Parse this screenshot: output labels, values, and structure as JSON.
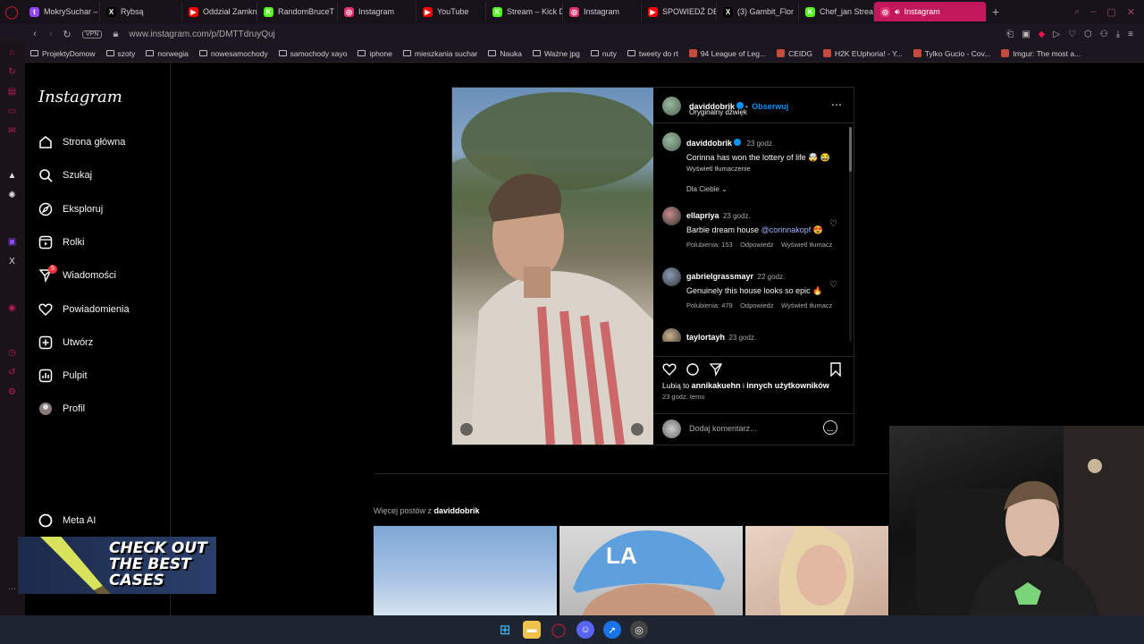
{
  "browser": {
    "tabs": [
      {
        "label": "MokrySuchar – ",
        "icon": "twitch-icon",
        "color": "#9146ff",
        "glyph": "t"
      },
      {
        "label": "Rybsą",
        "icon": "x-icon",
        "color": "#000000",
        "glyph": "X"
      },
      {
        "label": "Oddział Zamkn",
        "icon": "youtube-icon",
        "color": "#ff0000",
        "glyph": "▶"
      },
      {
        "label": "RandomBruceT",
        "icon": "kick-icon",
        "color": "#53fc18",
        "glyph": "K"
      },
      {
        "label": "Instagram",
        "icon": "instagram-icon",
        "color": "#e1306c",
        "glyph": "◎"
      },
      {
        "label": "YouTube",
        "icon": "youtube-icon",
        "color": "#ff0000",
        "glyph": "▶"
      },
      {
        "label": "Stream – Kick D",
        "icon": "kick-icon",
        "color": "#53fc18",
        "glyph": "K"
      },
      {
        "label": "Instagram",
        "icon": "instagram-icon",
        "color": "#e1306c",
        "glyph": "◎"
      },
      {
        "label": "SPOWIEDŹ DEN",
        "icon": "youtube-icon",
        "color": "#ff0000",
        "glyph": "▶"
      },
      {
        "label": "(3) Gambit_Flor",
        "icon": "x-icon",
        "color": "#000000",
        "glyph": "X"
      },
      {
        "label": "Chef_jan Strea",
        "icon": "kick-icon",
        "color": "#53fc18",
        "glyph": "K"
      }
    ],
    "active_tab": "Instagram",
    "url": "www.instagram.com/p/DMTTdruyQuj",
    "vpn": "VPN",
    "bookmarks": [
      {
        "label": "ProjektyDomow",
        "icon": "folder-icon"
      },
      {
        "label": "szoty",
        "icon": "folder-icon"
      },
      {
        "label": "norwegia",
        "icon": "folder-icon"
      },
      {
        "label": "nowesamochody",
        "icon": "folder-icon"
      },
      {
        "label": "samochody xayo",
        "icon": "folder-icon"
      },
      {
        "label": "iphone",
        "icon": "folder-icon"
      },
      {
        "label": "mieszkania suchar",
        "icon": "folder-icon"
      },
      {
        "label": "Nauka",
        "icon": "folder-icon"
      },
      {
        "label": "Ważne jpg",
        "icon": "folder-icon"
      },
      {
        "label": "nuty",
        "icon": "folder-icon"
      },
      {
        "label": "tweety do rt",
        "icon": "folder-icon"
      },
      {
        "label": "94 League of Leg...",
        "icon": "site-icon"
      },
      {
        "label": "CEIDG",
        "icon": "site-icon"
      },
      {
        "label": "H2K EUphoria! - Y...",
        "icon": "site-icon"
      },
      {
        "label": "Tylko Gucio - Cov...",
        "icon": "site-icon"
      },
      {
        "label": "Imgur: The most a...",
        "icon": "site-icon"
      }
    ]
  },
  "instagram": {
    "logo": "Instagram",
    "nav": [
      {
        "label": "Strona główna",
        "icon": "home-icon"
      },
      {
        "label": "Szukaj",
        "icon": "search-icon"
      },
      {
        "label": "Eksploruj",
        "icon": "compass-icon"
      },
      {
        "label": "Rolki",
        "icon": "reels-icon"
      },
      {
        "label": "Wiadomości",
        "icon": "messenger-icon",
        "badge": "5"
      },
      {
        "label": "Powiadomienia",
        "icon": "heart-icon"
      },
      {
        "label": "Utwórz",
        "icon": "plus-square-icon"
      },
      {
        "label": "Pulpit",
        "icon": "dashboard-icon"
      },
      {
        "label": "Profil",
        "icon": "profile-avatar-icon"
      }
    ],
    "meta_ai": "Meta AI",
    "post": {
      "author": "daviddobrik",
      "follow": "Obserwuj",
      "audio": "Oryginalny dźwięk",
      "caption_user": "daviddobrik",
      "caption_time": "23 godz.",
      "caption": "Corinna has won the lottery of life 🤯 😂",
      "translate": "Wyświetl tłumaczenie",
      "filter": "Dla Ciebie",
      "comments": [
        {
          "user": "ellapriya",
          "time": "23 godz.",
          "text": "Barbie dream house ",
          "mention": "@corinnakopf",
          "emoji": "😍",
          "likes": "Polubienia: 153",
          "reply": "Odpowiedz",
          "translate": "Wyświetl tłumacz"
        },
        {
          "user": "gabrielgrassmayr",
          "time": "22 godz.",
          "text": "Genuinely this house looks so epic",
          "mention": "",
          "emoji": "🔥",
          "likes": "Polubienia: 479",
          "reply": "Odpowiedz",
          "translate": "Wyświetl tłumacz"
        },
        {
          "user": "taylortayh",
          "time": "23 godz.",
          "text": "",
          "mention": "",
          "emoji": "",
          "likes": "",
          "reply": "",
          "translate": ""
        }
      ],
      "liked_prefix": "Lubią to ",
      "liked_user": "annikakuehn",
      "liked_mid": " i ",
      "liked_others": "innych użytkowników",
      "post_time": "23 godz. temu",
      "comment_placeholder": "Dodaj komentarz..."
    },
    "more_prefix": "Więcej postów z ",
    "more_user": "daviddobrik"
  },
  "ad": {
    "text_line1": "CHECK OUT",
    "text_line2": "THE BEST",
    "text_line3": "CASES"
  },
  "colors": {
    "accent": "#c2185b",
    "ig_blue": "#0095f6",
    "badge": "#ff3040"
  }
}
